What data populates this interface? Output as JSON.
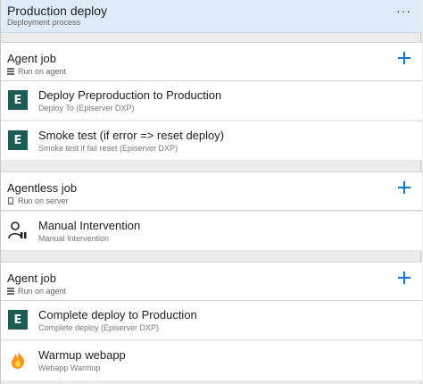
{
  "process": {
    "title": "Production deploy",
    "subtitle": "Deployment process",
    "more": "···"
  },
  "phases": [
    {
      "title": "Agent job",
      "subtitle": "Run on agent",
      "tasks": [
        {
          "title": "Deploy Preproduction to Production",
          "subtitle": "Deploy To (Episerver DXP)",
          "icon": "E"
        },
        {
          "title": "Smoke test (if error => reset deploy)",
          "subtitle": "Smoke test if fail reset (Episerver DXP)",
          "icon": "E"
        }
      ]
    },
    {
      "title": "Agentless job",
      "subtitle": "Run on server",
      "tasks": [
        {
          "title": "Manual Intervention",
          "subtitle": "Manual Intervention",
          "icon": "person-icon"
        }
      ]
    },
    {
      "title": "Agent job",
      "subtitle": "Run on agent",
      "tasks": [
        {
          "title": "Complete deploy to Production",
          "subtitle": "Complete deploy (Episerver DXP)",
          "icon": "E"
        },
        {
          "title": "Warmup webapp",
          "subtitle": "Webapp Warmup",
          "icon": "flame-icon"
        }
      ]
    }
  ],
  "colors": {
    "accent": "#0078d4",
    "header_bg": "#deecf9",
    "episerver_icon_bg": "#1b5c57"
  }
}
